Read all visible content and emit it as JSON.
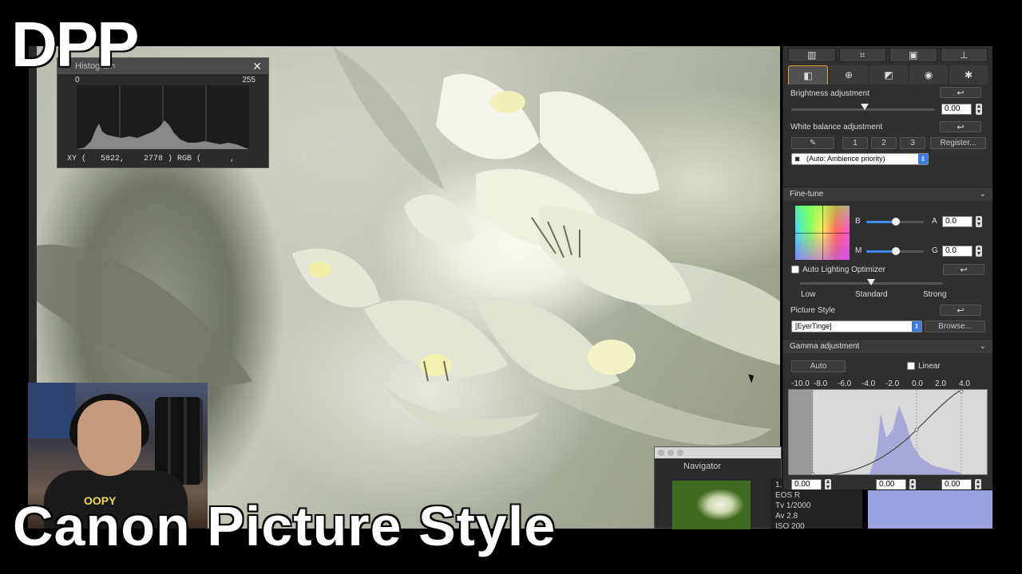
{
  "overlay": {
    "dpp": "DPP",
    "title": "Canon Picture Style",
    "shirt_text": "OOPY"
  },
  "histogram": {
    "title": "Histogram",
    "close": "✕",
    "scale_min": "0",
    "scale_max": "255",
    "readout": "XY (   5822,    2778 ) RGB (      ,       ,      )"
  },
  "navigator": {
    "title": "Navigator"
  },
  "exif": {
    "zoom": "1.",
    "camera": "EOS R",
    "tv": "Tv 1/2000",
    "av": "Av 2.8",
    "iso": "ISO 200"
  },
  "palette": {
    "top_icons": [
      "film-icon",
      "crop-icon",
      "image-icon",
      "stamp-icon"
    ],
    "tabs": [
      {
        "name": "basic-tab-icon",
        "glyph": "◧",
        "active": true
      },
      {
        "name": "detail-tab-icon",
        "glyph": "⊕",
        "active": false
      },
      {
        "name": "tone-tab-icon",
        "glyph": "◩",
        "active": false
      },
      {
        "name": "color-tab-icon",
        "glyph": "◉",
        "active": false
      },
      {
        "name": "settings-tab-icon",
        "glyph": "✱",
        "active": false
      }
    ],
    "brightness": {
      "label": "Brightness adjustment",
      "value": "0.00"
    },
    "white_balance": {
      "label": "White balance adjustment",
      "slots": [
        "1",
        "2",
        "3"
      ],
      "register": "Register...",
      "mode": "(Auto: Ambience priority)"
    },
    "fine_tune": {
      "header": "Fine-tune",
      "b_label": "B",
      "a_label": "A",
      "a_value": "0.0",
      "m_label": "M",
      "g_label": "G",
      "g_value": "0.0"
    },
    "alo": {
      "label": "Auto Lighting Optimizer",
      "low": "Low",
      "standard": "Standard",
      "strong": "Strong"
    },
    "picture_style": {
      "label": "Picture Style",
      "value": "[EyerTinge]",
      "browse": "Browse..."
    },
    "gamma": {
      "header": "Gamma adjustment",
      "auto": "Auto",
      "linear": "Linear",
      "ticks": [
        "-10.0",
        "-8.0",
        "-6.0",
        "-4.0",
        "-2.0",
        "0.0",
        "2.0",
        "4.0"
      ],
      "value_left": "0.00",
      "value_mid": "0.00",
      "value_right": "0.00"
    }
  },
  "colors": {
    "accent": "#3b8ef0",
    "active_tab_border": "#f0a030",
    "panel": "#2f2f2f"
  }
}
